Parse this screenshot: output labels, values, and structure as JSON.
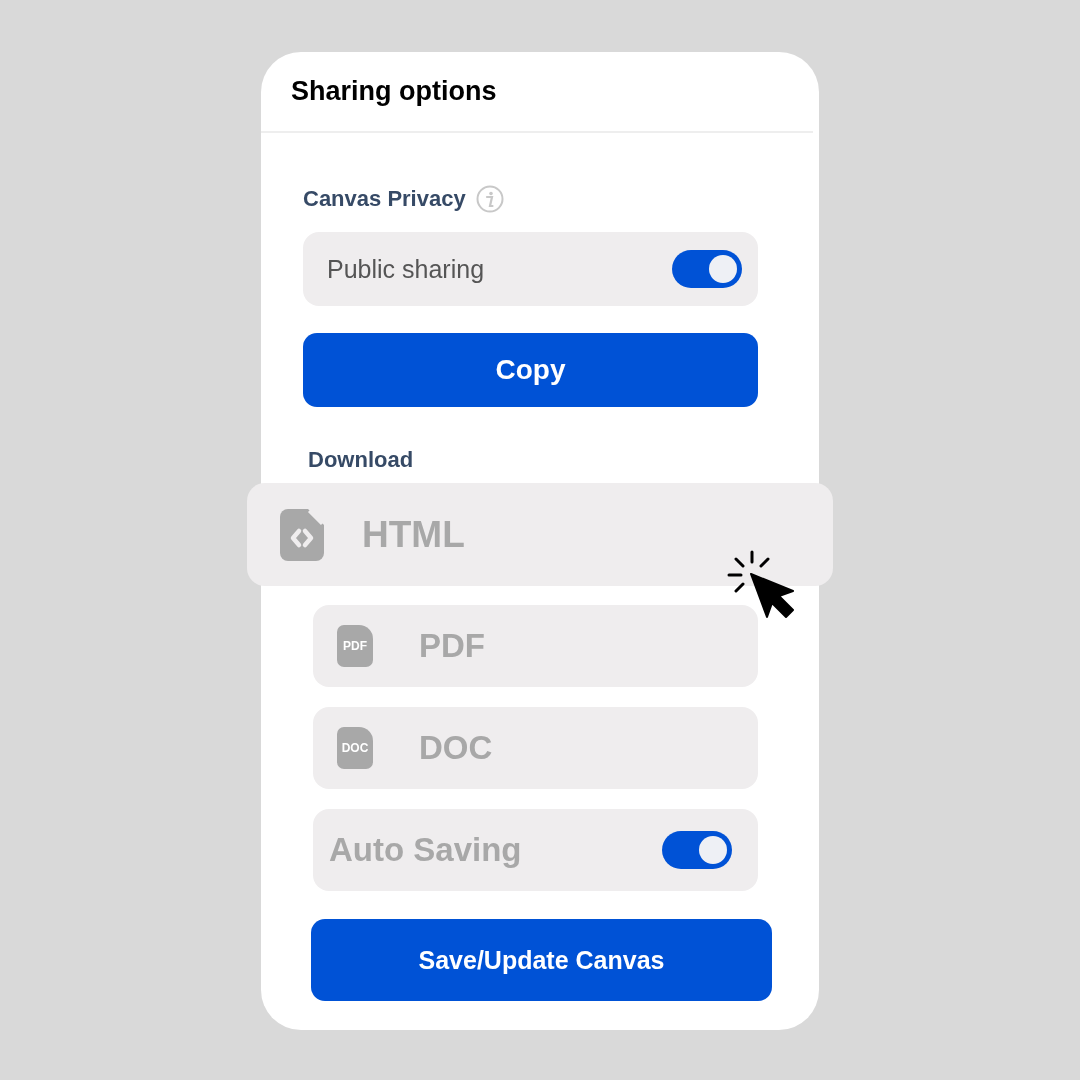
{
  "panel": {
    "title": "Sharing options"
  },
  "privacy": {
    "heading": "Canvas Privacy",
    "toggle": {
      "label": "Public sharing",
      "on": true
    }
  },
  "copy_button": "Copy",
  "download": {
    "heading": "Download",
    "items": [
      {
        "label": "HTML",
        "kind": "code",
        "selected": true
      },
      {
        "label": "PDF",
        "kind": "labeled",
        "icon_text": "PDF",
        "selected": false
      },
      {
        "label": "DOC",
        "kind": "labeled",
        "icon_text": "DOC",
        "selected": false
      }
    ]
  },
  "auto_saving": {
    "label": "Auto Saving",
    "on": true
  },
  "save_button": "Save/Update Canvas"
}
